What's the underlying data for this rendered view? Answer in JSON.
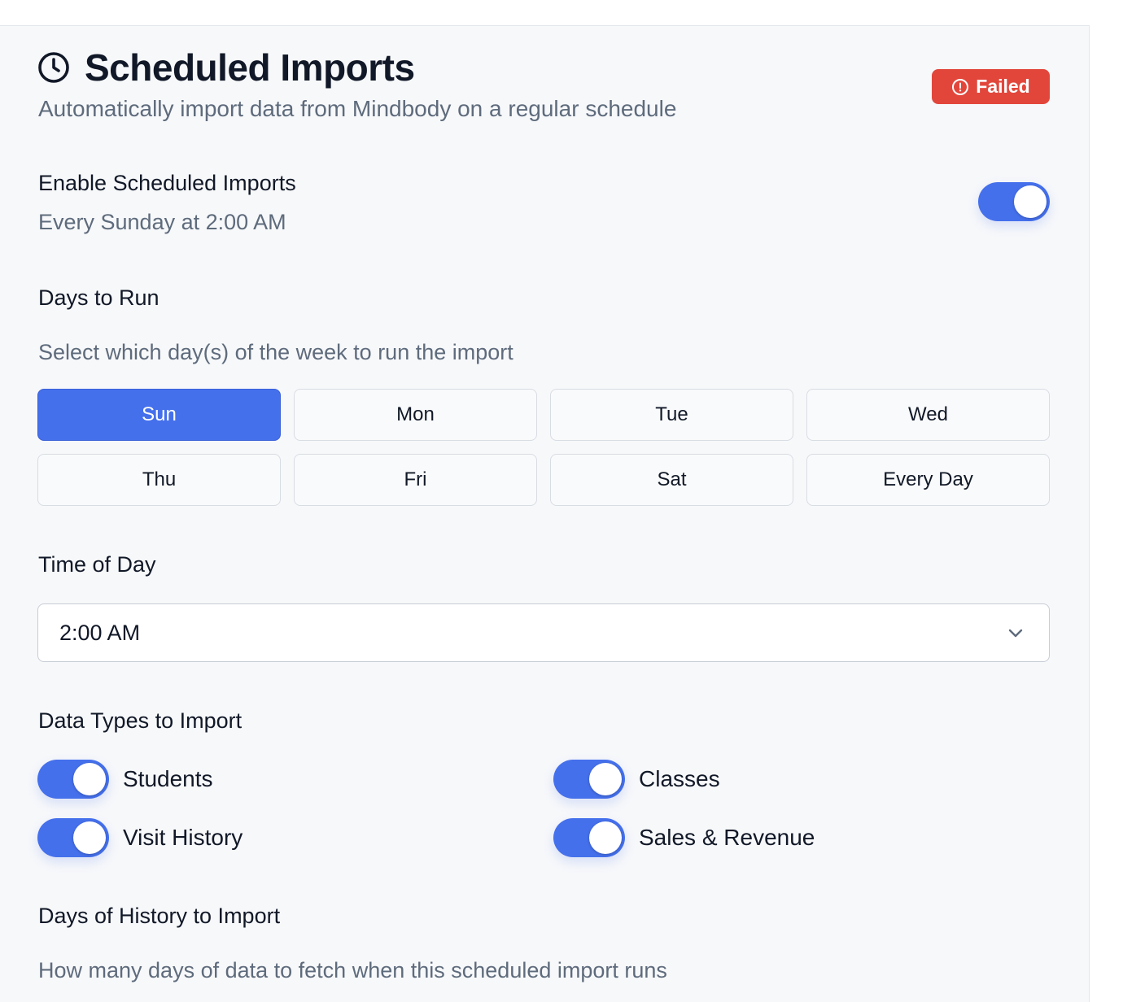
{
  "header": {
    "title": "Scheduled Imports",
    "subtitle": "Automatically import data from Mindbody on a regular schedule",
    "status_badge": "Failed",
    "icon": "clock-icon"
  },
  "enable": {
    "label": "Enable Scheduled Imports",
    "summary": "Every Sunday at 2:00 AM",
    "enabled": true
  },
  "days": {
    "label": "Days to Run",
    "helper": "Select which day(s) of the week to run the import",
    "options": [
      "Sun",
      "Mon",
      "Tue",
      "Wed",
      "Thu",
      "Fri",
      "Sat",
      "Every Day"
    ],
    "selected": "Sun"
  },
  "time": {
    "label": "Time of Day",
    "value": "2:00 AM"
  },
  "data_types": {
    "label": "Data Types to Import",
    "items": [
      {
        "label": "Students",
        "enabled": true
      },
      {
        "label": "Classes",
        "enabled": true
      },
      {
        "label": "Visit History",
        "enabled": true
      },
      {
        "label": "Sales & Revenue",
        "enabled": true
      }
    ]
  },
  "history": {
    "label": "Days of History to Import",
    "helper": "How many days of data to fetch when this scheduled import runs"
  },
  "colors": {
    "accent": "#4570ec",
    "danger": "#e2463b",
    "muted_text": "#5e6b7c"
  }
}
